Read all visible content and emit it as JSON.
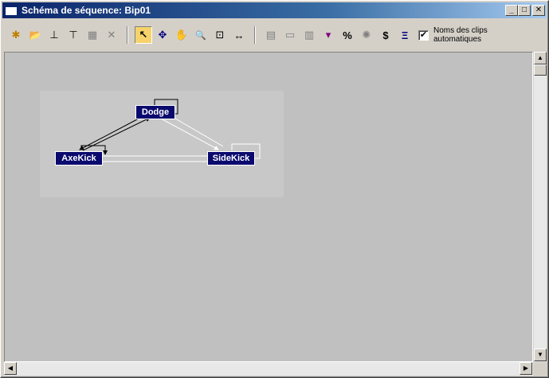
{
  "window": {
    "title": "Schéma de séquence: Bip01",
    "minimize_glyph": "_",
    "maximize_glyph": "□",
    "close_glyph": "✕"
  },
  "toolbar": {
    "tools_group1": [
      {
        "name": "new-clip-icon",
        "glyph": "✱"
      },
      {
        "name": "open-clip-icon",
        "glyph": "📂"
      },
      {
        "name": "insert-clip-icon",
        "glyph": "⊥"
      },
      {
        "name": "insert-transition-icon",
        "glyph": "⊤"
      },
      {
        "name": "delete-clip-icon",
        "glyph": "▦"
      },
      {
        "name": "delete-icon",
        "glyph": "✕"
      }
    ],
    "tools_group2": [
      {
        "name": "select-arrow-icon",
        "glyph": "↖"
      },
      {
        "name": "move-icon",
        "glyph": "✥"
      },
      {
        "name": "pan-hand-icon",
        "glyph": "✋"
      },
      {
        "name": "zoom-icon",
        "glyph": "🔍"
      },
      {
        "name": "zoom-region-icon",
        "glyph": "⊡"
      },
      {
        "name": "zoom-extents-icon",
        "glyph": "↔"
      }
    ],
    "tools_group3": [
      {
        "name": "clip-props-icon",
        "glyph": "▤"
      },
      {
        "name": "transition-icon",
        "glyph": "▭"
      },
      {
        "name": "random-icon",
        "glyph": "▥"
      },
      {
        "name": "set-start-icon",
        "glyph": "▾"
      },
      {
        "name": "percent-icon",
        "glyph": "%"
      },
      {
        "name": "optimize-icon",
        "glyph": "✺"
      },
      {
        "name": "cost-icon",
        "glyph": "$"
      },
      {
        "name": "transition-info-icon",
        "glyph": "Ξ"
      }
    ],
    "auto_clip_names": {
      "checked_glyph": "✔",
      "label": "Noms des clips automatiques"
    }
  },
  "graph": {
    "nodes": [
      {
        "name": "Dodge"
      },
      {
        "name": "AxeKick"
      },
      {
        "name": "SideKick"
      }
    ]
  },
  "scrollbars": {
    "up": "▲",
    "down": "▼",
    "left": "◀",
    "right": "▶"
  }
}
